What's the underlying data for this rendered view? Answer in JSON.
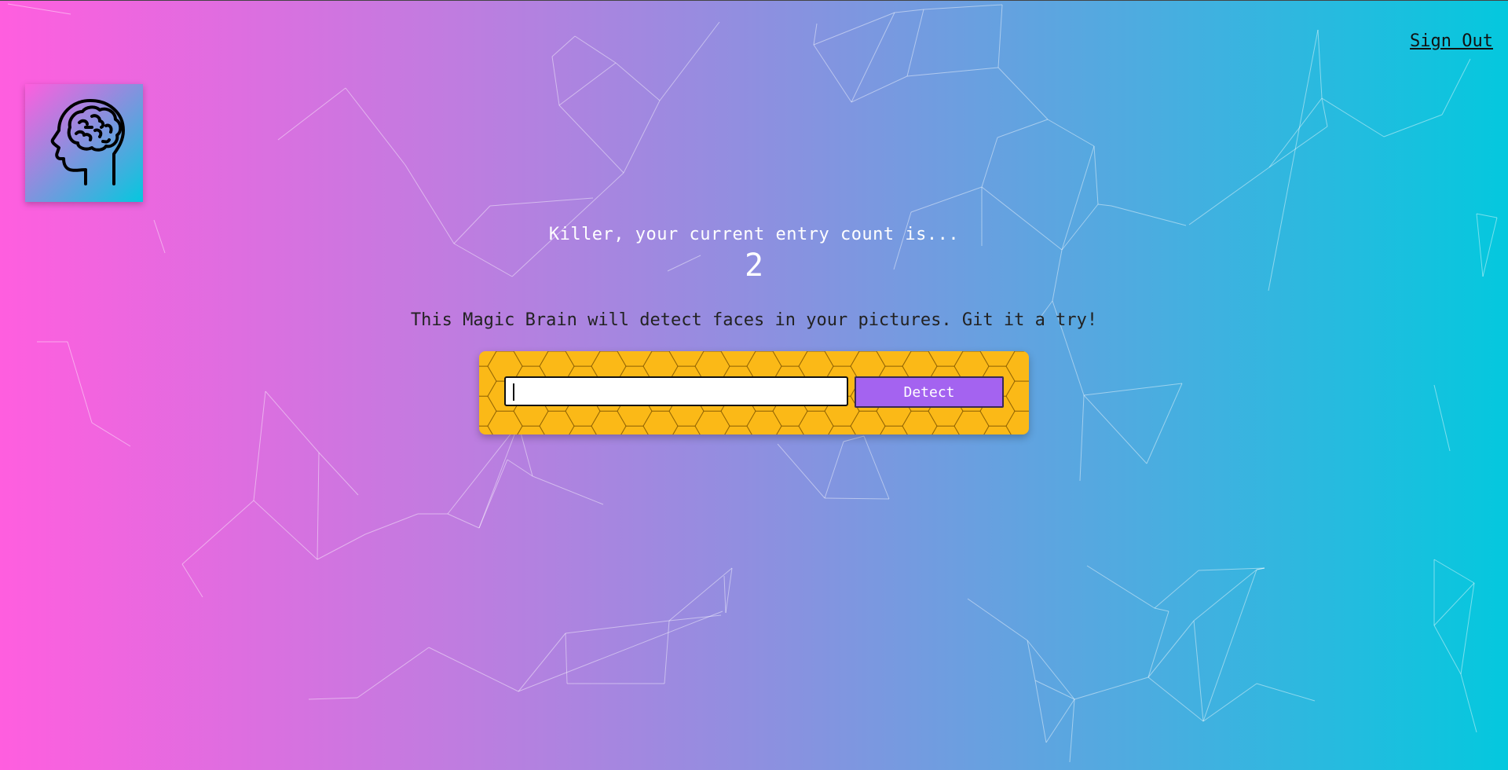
{
  "nav": {
    "sign_out_label": "Sign Out"
  },
  "logo": {
    "icon": "brain-head-icon"
  },
  "rank": {
    "label": "Killer, your current entry count is...",
    "count": "2"
  },
  "description": "This Magic Brain will detect faces in your pictures. Git it a try!",
  "form": {
    "input_value": "",
    "button_label": "Detect"
  },
  "colors": {
    "gradient_start": "#ff5edf",
    "gradient_end": "#04c8de",
    "form_background": "#fbb917",
    "button_background": "#a463f0"
  }
}
